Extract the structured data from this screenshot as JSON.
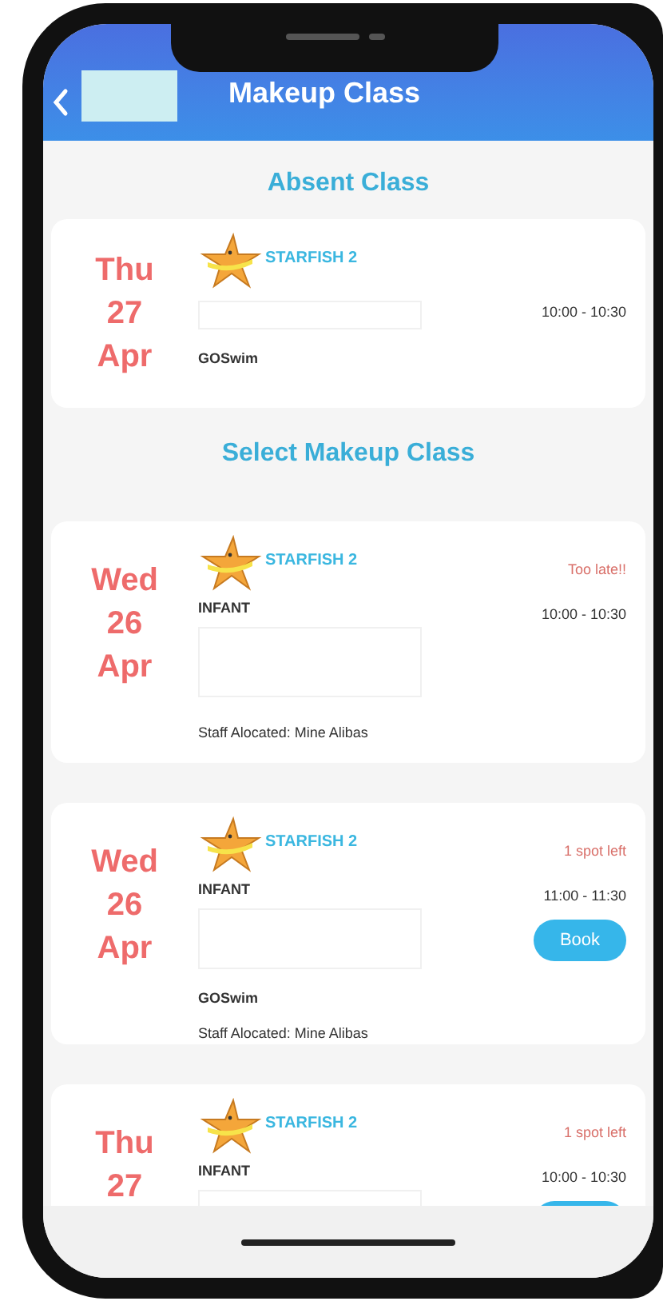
{
  "header": {
    "title": "Makeup Class"
  },
  "sections": [
    {
      "title": "Absent Class",
      "cards": [
        {
          "day": "Thu",
          "date": "27",
          "month": "Apr",
          "class_name": "STARFISH 2",
          "time": "10:00 - 10:30",
          "venue": "GOSwim"
        }
      ]
    },
    {
      "title": "Select Makeup Class",
      "cards": [
        {
          "day": "Wed",
          "date": "26",
          "month": "Apr",
          "class_name": "STARFISH 2",
          "level": "INFANT",
          "status": "Too late!!",
          "time": "10:00 - 10:30",
          "staff": "Staff Alocated: Mine Alibas"
        },
        {
          "day": "Wed",
          "date": "26",
          "month": "Apr",
          "class_name": "STARFISH 2",
          "level": "INFANT",
          "status": "1 spot left",
          "time": "11:00 - 11:30",
          "button": "Book",
          "venue": "GOSwim",
          "staff": "Staff Alocated: Mine Alibas"
        },
        {
          "day": "Thu",
          "date": "27",
          "class_name": "STARFISH 2",
          "level": "INFANT",
          "status": "1 spot left",
          "time": "10:00 - 10:30",
          "button_shown": true
        }
      ]
    }
  ]
}
